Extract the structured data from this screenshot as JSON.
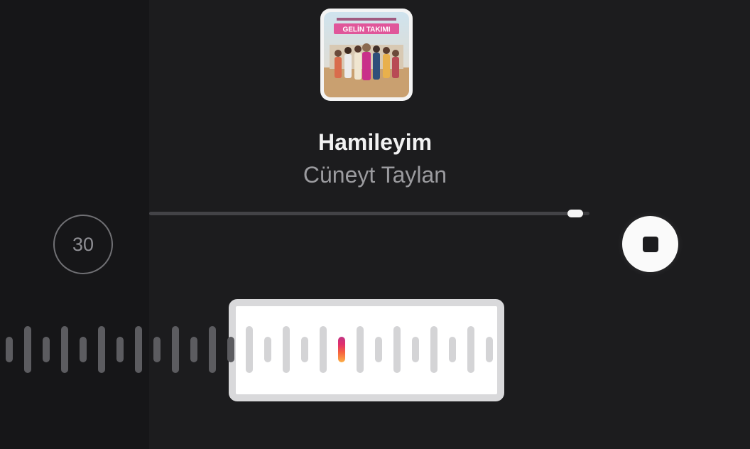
{
  "track": {
    "title": "Hamileyim",
    "artist": "Cüneyt Taylan",
    "cover": {
      "icon": "album-cover-image",
      "caption": "GELİN TAKIMI",
      "accent": "#e0569a"
    }
  },
  "progress": {
    "fraction": 0.985
  },
  "duration_button": {
    "label": "30",
    "icon": "duration-circle"
  },
  "stop_button": {
    "icon": "stop-icon"
  },
  "waveform": {
    "outside_color": "#5c5c60",
    "inside_color": "#d4d4d6",
    "window_color": "#d9d9db",
    "playhead_colors": [
      "#c13584",
      "#e1306c",
      "#f56040",
      "#fcaf45"
    ],
    "selected_fraction": 0.5
  },
  "colors": {
    "background": "#1c1c1e",
    "side_panel": "#161618",
    "title": "#f2f2f2",
    "artist": "#9b9b9f"
  }
}
